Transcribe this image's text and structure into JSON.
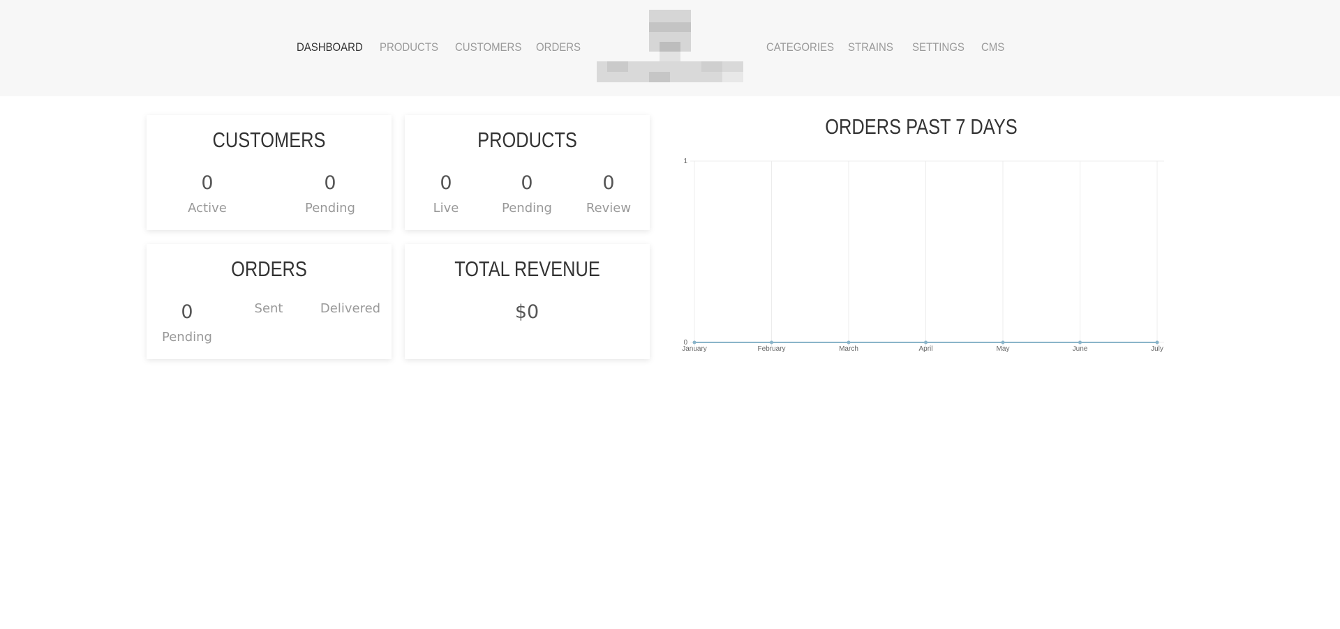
{
  "nav": {
    "left": [
      {
        "label": "DASHBOARD",
        "active": true
      },
      {
        "label": "PRODUCTS",
        "active": false
      },
      {
        "label": "CUSTOMERS",
        "active": false
      },
      {
        "label": "ORDERS",
        "active": false
      }
    ],
    "right": [
      {
        "label": "CATEGORIES",
        "active": false
      },
      {
        "label": "STRAINS",
        "active": false
      },
      {
        "label": "SETTINGS",
        "active": false
      },
      {
        "label": "CMS",
        "active": false
      }
    ]
  },
  "cards": {
    "customers": {
      "title": "CUSTOMERS",
      "active": {
        "value": "0",
        "label": "Active"
      },
      "pending": {
        "value": "0",
        "label": "Pending"
      }
    },
    "products": {
      "title": "PRODUCTS",
      "live": {
        "value": "0",
        "label": "Live"
      },
      "pending": {
        "value": "0",
        "label": "Pending"
      },
      "review": {
        "value": "0",
        "label": "Review"
      }
    },
    "orders": {
      "title": "ORDERS",
      "pending": {
        "value": "0",
        "label": "Pending"
      },
      "sent": {
        "label": "Sent"
      },
      "delivered": {
        "label": "Delivered"
      }
    },
    "revenue": {
      "title": "TOTAL REVENUE",
      "value": "$0"
    }
  },
  "chart_title": "ORDERS PAST 7 DAYS",
  "chart_data": {
    "type": "line",
    "title": "ORDERS PAST 7 DAYS",
    "categories": [
      "January",
      "February",
      "March",
      "April",
      "May",
      "June",
      "July"
    ],
    "series": [
      {
        "values": [
          0,
          0,
          0,
          0,
          0,
          0,
          0
        ],
        "color": "#8ab4c9"
      }
    ],
    "ylim": [
      0,
      1
    ],
    "yticks": [
      "0",
      "1"
    ],
    "grid": true
  }
}
